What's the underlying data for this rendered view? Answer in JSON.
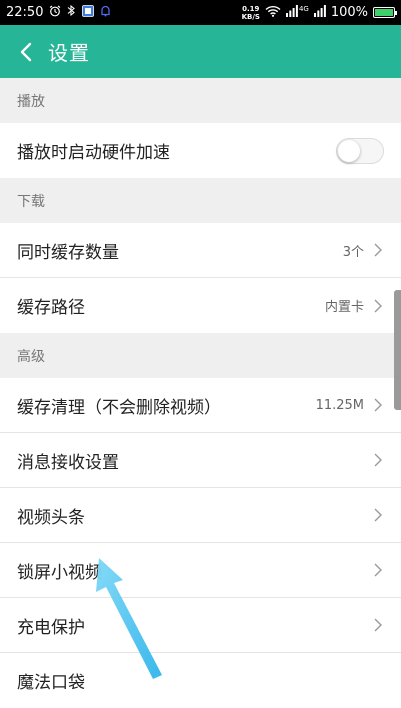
{
  "status_bar": {
    "time": "22:50",
    "net_speed_value": "0.19",
    "net_speed_unit": "KB/S",
    "signal_label": "4G",
    "battery": "100%",
    "battery_level": 1.0,
    "icons": [
      "alarm-icon",
      "bluetooth-icon",
      "app-notification-icon",
      "ring-icon",
      "wifi-icon",
      "signal-icon",
      "battery-icon"
    ]
  },
  "title_bar": {
    "title": "设置",
    "back_icon": "chevron-left-icon"
  },
  "sections": {
    "playback": {
      "header": "播放",
      "items": [
        {
          "label": "播放时启动硬件加速",
          "toggle": false
        }
      ]
    },
    "download": {
      "header": "下载",
      "items": [
        {
          "label": "同时缓存数量",
          "value": "3个"
        },
        {
          "label": "缓存路径",
          "value": "内置卡"
        }
      ]
    },
    "advanced": {
      "header": "高级",
      "items": [
        {
          "label": "缓存清理（不会删除视频）",
          "value": "11.25M"
        },
        {
          "label": "消息接收设置"
        },
        {
          "label": "视频头条"
        },
        {
          "label": "锁屏小视频"
        },
        {
          "label": "充电保护"
        },
        {
          "label": "魔法口袋"
        }
      ]
    }
  },
  "colors": {
    "accent": "#27b597",
    "status_bar_bg": "#000000",
    "page_bg": "#efefef",
    "annotation_arrow": "#45c3f0"
  }
}
